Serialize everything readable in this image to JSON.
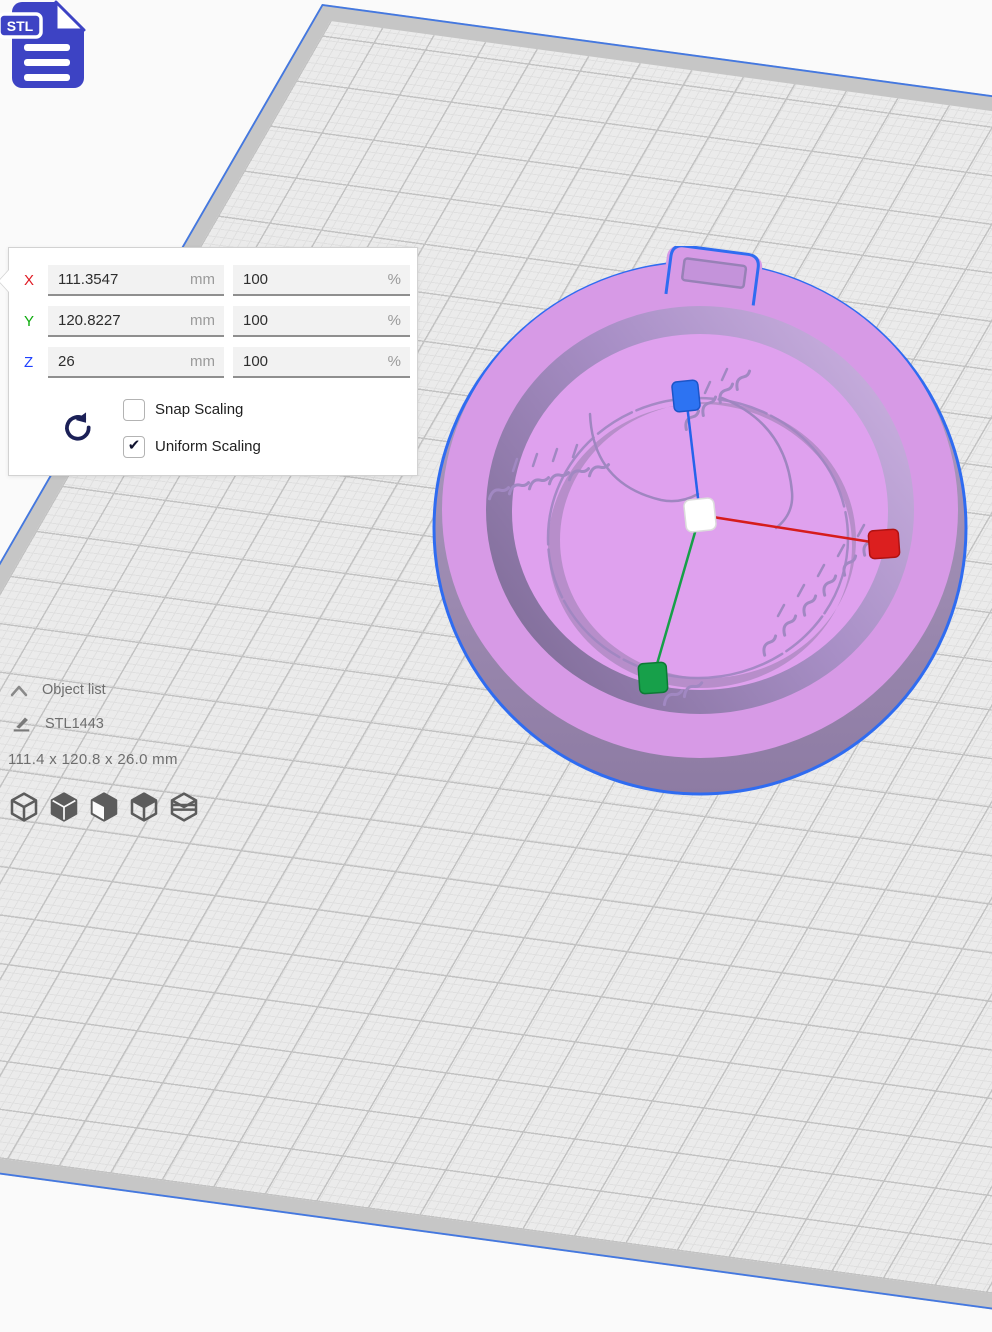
{
  "file_button": {
    "label": "STL"
  },
  "scale_tool": {
    "axes": [
      {
        "axis": "X",
        "value": "111.3547",
        "unit": "mm",
        "percent": "100",
        "percent_unit": "%"
      },
      {
        "axis": "Y",
        "value": "120.8227",
        "unit": "mm",
        "percent": "100",
        "percent_unit": "%"
      },
      {
        "axis": "Z",
        "value": "26",
        "unit": "mm",
        "percent": "100",
        "percent_unit": "%"
      }
    ],
    "snap": {
      "label": "Snap Scaling",
      "checked": false
    },
    "uniform": {
      "label": "Uniform Scaling",
      "checked": true
    }
  },
  "object_list": {
    "header": "Object list",
    "items": [
      {
        "name": "STL1443"
      }
    ],
    "selected_dimensions": "111.4 x 120.8 x 26.0 mm"
  },
  "scene": {
    "model": "baseball keychain mold",
    "model_color": "#d79ae6",
    "selection_outline_color": "#2f6cf1",
    "handle_colors": {
      "x_axis": "#d61c1c",
      "y_axis": "#16a048",
      "z_axis": "#2563eb",
      "center": "#ffffff"
    },
    "plate_edge_color": "#4478e0"
  }
}
